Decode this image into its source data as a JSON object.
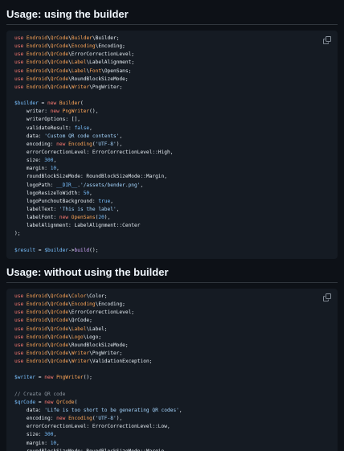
{
  "sections": [
    {
      "heading": "Usage: using the builder",
      "copy_icon": "copy-icon",
      "code_lines": [
        [
          {
            "t": "use ",
            "c": "kw"
          },
          {
            "t": "Endroid",
            "c": "ns"
          },
          {
            "t": "\\",
            "c": ""
          },
          {
            "t": "QrCode",
            "c": "ns"
          },
          {
            "t": "\\",
            "c": ""
          },
          {
            "t": "Builder",
            "c": "ns"
          },
          {
            "t": "\\Builder;",
            "c": ""
          }
        ],
        [
          {
            "t": "use ",
            "c": "kw"
          },
          {
            "t": "Endroid",
            "c": "ns"
          },
          {
            "t": "\\",
            "c": ""
          },
          {
            "t": "QrCode",
            "c": "ns"
          },
          {
            "t": "\\",
            "c": ""
          },
          {
            "t": "Encoding",
            "c": "ns"
          },
          {
            "t": "\\Encoding;",
            "c": ""
          }
        ],
        [
          {
            "t": "use ",
            "c": "kw"
          },
          {
            "t": "Endroid",
            "c": "ns"
          },
          {
            "t": "\\",
            "c": ""
          },
          {
            "t": "QrCode",
            "c": "ns"
          },
          {
            "t": "\\ErrorCorrectionLevel;",
            "c": ""
          }
        ],
        [
          {
            "t": "use ",
            "c": "kw"
          },
          {
            "t": "Endroid",
            "c": "ns"
          },
          {
            "t": "\\",
            "c": ""
          },
          {
            "t": "QrCode",
            "c": "ns"
          },
          {
            "t": "\\",
            "c": ""
          },
          {
            "t": "Label",
            "c": "ns"
          },
          {
            "t": "\\LabelAlignment;",
            "c": ""
          }
        ],
        [
          {
            "t": "use ",
            "c": "kw"
          },
          {
            "t": "Endroid",
            "c": "ns"
          },
          {
            "t": "\\",
            "c": ""
          },
          {
            "t": "QrCode",
            "c": "ns"
          },
          {
            "t": "\\",
            "c": ""
          },
          {
            "t": "Label",
            "c": "ns"
          },
          {
            "t": "\\",
            "c": ""
          },
          {
            "t": "Font",
            "c": "ns"
          },
          {
            "t": "\\OpenSans;",
            "c": ""
          }
        ],
        [
          {
            "t": "use ",
            "c": "kw"
          },
          {
            "t": "Endroid",
            "c": "ns"
          },
          {
            "t": "\\",
            "c": ""
          },
          {
            "t": "QrCode",
            "c": "ns"
          },
          {
            "t": "\\RoundBlockSizeMode;",
            "c": ""
          }
        ],
        [
          {
            "t": "use ",
            "c": "kw"
          },
          {
            "t": "Endroid",
            "c": "ns"
          },
          {
            "t": "\\",
            "c": ""
          },
          {
            "t": "QrCode",
            "c": "ns"
          },
          {
            "t": "\\",
            "c": ""
          },
          {
            "t": "Writer",
            "c": "ns"
          },
          {
            "t": "\\PngWriter;",
            "c": ""
          }
        ],
        [],
        [
          {
            "t": "$builder",
            "c": "vr"
          },
          {
            "t": " = ",
            "c": ""
          },
          {
            "t": "new ",
            "c": "kw"
          },
          {
            "t": "Builder",
            "c": "ns"
          },
          {
            "t": "(",
            "c": ""
          }
        ],
        [
          {
            "t": "    writer: ",
            "c": ""
          },
          {
            "t": "new ",
            "c": "kw"
          },
          {
            "t": "PngWriter",
            "c": "ns"
          },
          {
            "t": "(),",
            "c": ""
          }
        ],
        [
          {
            "t": "    writerOptions: [],",
            "c": ""
          }
        ],
        [
          {
            "t": "    validateResult: ",
            "c": ""
          },
          {
            "t": "false",
            "c": "vr"
          },
          {
            "t": ",",
            "c": ""
          }
        ],
        [
          {
            "t": "    data: ",
            "c": ""
          },
          {
            "t": "'Custom QR code contents'",
            "c": "str"
          },
          {
            "t": ",",
            "c": ""
          }
        ],
        [
          {
            "t": "    encoding: ",
            "c": ""
          },
          {
            "t": "new ",
            "c": "kw"
          },
          {
            "t": "Encoding",
            "c": "ns"
          },
          {
            "t": "(",
            "c": ""
          },
          {
            "t": "'UTF-8'",
            "c": "str"
          },
          {
            "t": "),",
            "c": ""
          }
        ],
        [
          {
            "t": "    errorCorrectionLevel: ErrorCorrectionLevel::High,",
            "c": ""
          }
        ],
        [
          {
            "t": "    size: ",
            "c": ""
          },
          {
            "t": "300",
            "c": "vr"
          },
          {
            "t": ",",
            "c": ""
          }
        ],
        [
          {
            "t": "    margin: ",
            "c": ""
          },
          {
            "t": "10",
            "c": "vr"
          },
          {
            "t": ",",
            "c": ""
          }
        ],
        [
          {
            "t": "    roundBlockSizeMode: RoundBlockSizeMode::Margin,",
            "c": ""
          }
        ],
        [
          {
            "t": "    logoPath: ",
            "c": ""
          },
          {
            "t": "__DIR__",
            "c": "vr"
          },
          {
            "t": ".",
            "c": ""
          },
          {
            "t": "'/assets/bender.png'",
            "c": "str"
          },
          {
            "t": ",",
            "c": ""
          }
        ],
        [
          {
            "t": "    logoResizeToWidth: ",
            "c": ""
          },
          {
            "t": "50",
            "c": "vr"
          },
          {
            "t": ",",
            "c": ""
          }
        ],
        [
          {
            "t": "    logoPunchoutBackground: ",
            "c": ""
          },
          {
            "t": "true",
            "c": "vr"
          },
          {
            "t": ",",
            "c": ""
          }
        ],
        [
          {
            "t": "    labelText: ",
            "c": ""
          },
          {
            "t": "'This is the label'",
            "c": "str"
          },
          {
            "t": ",",
            "c": ""
          }
        ],
        [
          {
            "t": "    labelFont: ",
            "c": ""
          },
          {
            "t": "new ",
            "c": "kw"
          },
          {
            "t": "OpenSans",
            "c": "ns"
          },
          {
            "t": "(",
            "c": ""
          },
          {
            "t": "20",
            "c": "vr"
          },
          {
            "t": "),",
            "c": ""
          }
        ],
        [
          {
            "t": "    labelAlignment: LabelAlignment::Center",
            "c": ""
          }
        ],
        [
          {
            "t": ");",
            "c": ""
          }
        ],
        [],
        [
          {
            "t": "$result",
            "c": "vr"
          },
          {
            "t": " = ",
            "c": ""
          },
          {
            "t": "$builder",
            "c": "vr"
          },
          {
            "t": "->",
            "c": ""
          },
          {
            "t": "build",
            "c": "fn"
          },
          {
            "t": "();",
            "c": ""
          }
        ]
      ]
    },
    {
      "heading": "Usage: without using the builder",
      "copy_icon": "copy-icon",
      "code_lines": [
        [
          {
            "t": "use ",
            "c": "kw"
          },
          {
            "t": "Endroid",
            "c": "ns"
          },
          {
            "t": "\\",
            "c": ""
          },
          {
            "t": "QrCode",
            "c": "ns"
          },
          {
            "t": "\\",
            "c": ""
          },
          {
            "t": "Color",
            "c": "ns"
          },
          {
            "t": "\\Color;",
            "c": ""
          }
        ],
        [
          {
            "t": "use ",
            "c": "kw"
          },
          {
            "t": "Endroid",
            "c": "ns"
          },
          {
            "t": "\\",
            "c": ""
          },
          {
            "t": "QrCode",
            "c": "ns"
          },
          {
            "t": "\\",
            "c": ""
          },
          {
            "t": "Encoding",
            "c": "ns"
          },
          {
            "t": "\\Encoding;",
            "c": ""
          }
        ],
        [
          {
            "t": "use ",
            "c": "kw"
          },
          {
            "t": "Endroid",
            "c": "ns"
          },
          {
            "t": "\\",
            "c": ""
          },
          {
            "t": "QrCode",
            "c": "ns"
          },
          {
            "t": "\\ErrorCorrectionLevel;",
            "c": ""
          }
        ],
        [
          {
            "t": "use ",
            "c": "kw"
          },
          {
            "t": "Endroid",
            "c": "ns"
          },
          {
            "t": "\\",
            "c": ""
          },
          {
            "t": "QrCode",
            "c": "ns"
          },
          {
            "t": "\\QrCode;",
            "c": ""
          }
        ],
        [
          {
            "t": "use ",
            "c": "kw"
          },
          {
            "t": "Endroid",
            "c": "ns"
          },
          {
            "t": "\\",
            "c": ""
          },
          {
            "t": "QrCode",
            "c": "ns"
          },
          {
            "t": "\\",
            "c": ""
          },
          {
            "t": "Label",
            "c": "ns"
          },
          {
            "t": "\\Label;",
            "c": ""
          }
        ],
        [
          {
            "t": "use ",
            "c": "kw"
          },
          {
            "t": "Endroid",
            "c": "ns"
          },
          {
            "t": "\\",
            "c": ""
          },
          {
            "t": "QrCode",
            "c": "ns"
          },
          {
            "t": "\\",
            "c": ""
          },
          {
            "t": "Logo",
            "c": "ns"
          },
          {
            "t": "\\Logo;",
            "c": ""
          }
        ],
        [
          {
            "t": "use ",
            "c": "kw"
          },
          {
            "t": "Endroid",
            "c": "ns"
          },
          {
            "t": "\\",
            "c": ""
          },
          {
            "t": "QrCode",
            "c": "ns"
          },
          {
            "t": "\\RoundBlockSizeMode;",
            "c": ""
          }
        ],
        [
          {
            "t": "use ",
            "c": "kw"
          },
          {
            "t": "Endroid",
            "c": "ns"
          },
          {
            "t": "\\",
            "c": ""
          },
          {
            "t": "QrCode",
            "c": "ns"
          },
          {
            "t": "\\",
            "c": ""
          },
          {
            "t": "Writer",
            "c": "ns"
          },
          {
            "t": "\\PngWriter;",
            "c": ""
          }
        ],
        [
          {
            "t": "use ",
            "c": "kw"
          },
          {
            "t": "Endroid",
            "c": "ns"
          },
          {
            "t": "\\",
            "c": ""
          },
          {
            "t": "QrCode",
            "c": "ns"
          },
          {
            "t": "\\",
            "c": ""
          },
          {
            "t": "Writer",
            "c": "ns"
          },
          {
            "t": "\\ValidationException;",
            "c": ""
          }
        ],
        [],
        [
          {
            "t": "$writer",
            "c": "vr"
          },
          {
            "t": " = ",
            "c": ""
          },
          {
            "t": "new ",
            "c": "kw"
          },
          {
            "t": "PngWriter",
            "c": "ns"
          },
          {
            "t": "();",
            "c": ""
          }
        ],
        [],
        [
          {
            "t": "// Create QR code",
            "c": "cmt"
          }
        ],
        [
          {
            "t": "$qrCode",
            "c": "vr"
          },
          {
            "t": " = ",
            "c": ""
          },
          {
            "t": "new ",
            "c": "kw"
          },
          {
            "t": "QrCode",
            "c": "ns"
          },
          {
            "t": "(",
            "c": ""
          }
        ],
        [
          {
            "t": "    data: ",
            "c": ""
          },
          {
            "t": "'Life is too short to be generating QR codes'",
            "c": "str"
          },
          {
            "t": ",",
            "c": ""
          }
        ],
        [
          {
            "t": "    encoding: ",
            "c": ""
          },
          {
            "t": "new ",
            "c": "kw"
          },
          {
            "t": "Encoding",
            "c": "ns"
          },
          {
            "t": "(",
            "c": ""
          },
          {
            "t": "'UTF-8'",
            "c": "str"
          },
          {
            "t": "),",
            "c": ""
          }
        ],
        [
          {
            "t": "    errorCorrectionLevel: ErrorCorrectionLevel::Low,",
            "c": ""
          }
        ],
        [
          {
            "t": "    size: ",
            "c": ""
          },
          {
            "t": "300",
            "c": "vr"
          },
          {
            "t": ",",
            "c": ""
          }
        ],
        [
          {
            "t": "    margin: ",
            "c": ""
          },
          {
            "t": "10",
            "c": "vr"
          },
          {
            "t": ",",
            "c": ""
          }
        ],
        [
          {
            "t": "    roundBlockSizeMode: RoundBlockSizeMode::Margin,",
            "c": ""
          }
        ]
      ]
    }
  ]
}
